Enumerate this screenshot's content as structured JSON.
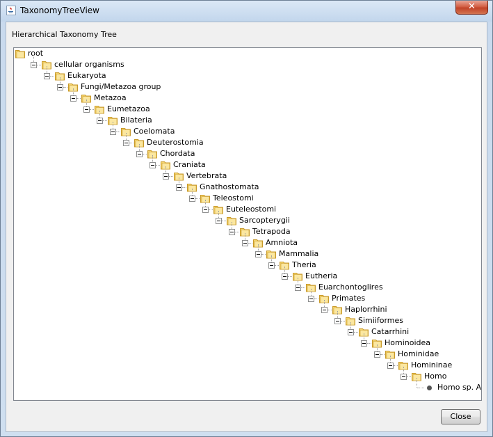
{
  "window": {
    "title": "TaxonomyTreeView",
    "close_glyph": "✕"
  },
  "panel": {
    "title": "Hierarchical Taxonomy Tree"
  },
  "tree": {
    "nodes": [
      {
        "label": "root",
        "depth": 0,
        "type": "folder",
        "expander": false
      },
      {
        "label": "cellular organisms",
        "depth": 1,
        "type": "folder",
        "expander": true
      },
      {
        "label": "Eukaryota",
        "depth": 2,
        "type": "folder",
        "expander": true
      },
      {
        "label": "Fungi/Metazoa group",
        "depth": 3,
        "type": "folder",
        "expander": true
      },
      {
        "label": "Metazoa",
        "depth": 4,
        "type": "folder",
        "expander": true
      },
      {
        "label": "Eumetazoa",
        "depth": 5,
        "type": "folder",
        "expander": true
      },
      {
        "label": "Bilateria",
        "depth": 6,
        "type": "folder",
        "expander": true
      },
      {
        "label": "Coelomata",
        "depth": 7,
        "type": "folder",
        "expander": true
      },
      {
        "label": "Deuterostomia",
        "depth": 8,
        "type": "folder",
        "expander": true
      },
      {
        "label": "Chordata",
        "depth": 9,
        "type": "folder",
        "expander": true
      },
      {
        "label": "Craniata",
        "depth": 10,
        "type": "folder",
        "expander": true
      },
      {
        "label": "Vertebrata",
        "depth": 11,
        "type": "folder",
        "expander": true
      },
      {
        "label": "Gnathostomata",
        "depth": 12,
        "type": "folder",
        "expander": true
      },
      {
        "label": "Teleostomi",
        "depth": 13,
        "type": "folder",
        "expander": true
      },
      {
        "label": "Euteleostomi",
        "depth": 14,
        "type": "folder",
        "expander": true
      },
      {
        "label": "Sarcopterygii",
        "depth": 15,
        "type": "folder",
        "expander": true
      },
      {
        "label": "Tetrapoda",
        "depth": 16,
        "type": "folder",
        "expander": true
      },
      {
        "label": "Amniota",
        "depth": 17,
        "type": "folder",
        "expander": true
      },
      {
        "label": "Mammalia",
        "depth": 18,
        "type": "folder",
        "expander": true
      },
      {
        "label": "Theria",
        "depth": 19,
        "type": "folder",
        "expander": true
      },
      {
        "label": "Eutheria",
        "depth": 20,
        "type": "folder",
        "expander": true
      },
      {
        "label": "Euarchontoglires",
        "depth": 21,
        "type": "folder",
        "expander": true
      },
      {
        "label": "Primates",
        "depth": 22,
        "type": "folder",
        "expander": true
      },
      {
        "label": "Haplorrhini",
        "depth": 23,
        "type": "folder",
        "expander": true
      },
      {
        "label": "Simiiformes",
        "depth": 24,
        "type": "folder",
        "expander": true
      },
      {
        "label": "Catarrhini",
        "depth": 25,
        "type": "folder",
        "expander": true
      },
      {
        "label": "Hominoidea",
        "depth": 26,
        "type": "folder",
        "expander": true
      },
      {
        "label": "Hominidae",
        "depth": 27,
        "type": "folder",
        "expander": true
      },
      {
        "label": "Homininae",
        "depth": 28,
        "type": "folder",
        "expander": true
      },
      {
        "label": "Homo",
        "depth": 29,
        "type": "folder",
        "expander": true
      },
      {
        "label": "Homo sp. Altai",
        "depth": 30,
        "type": "leaf",
        "expander": false
      }
    ]
  },
  "footer": {
    "close_label": "Close"
  },
  "colors": {
    "folder_fill": "#f4d36b",
    "folder_edge": "#c99a2a",
    "leaf": "#555555"
  }
}
